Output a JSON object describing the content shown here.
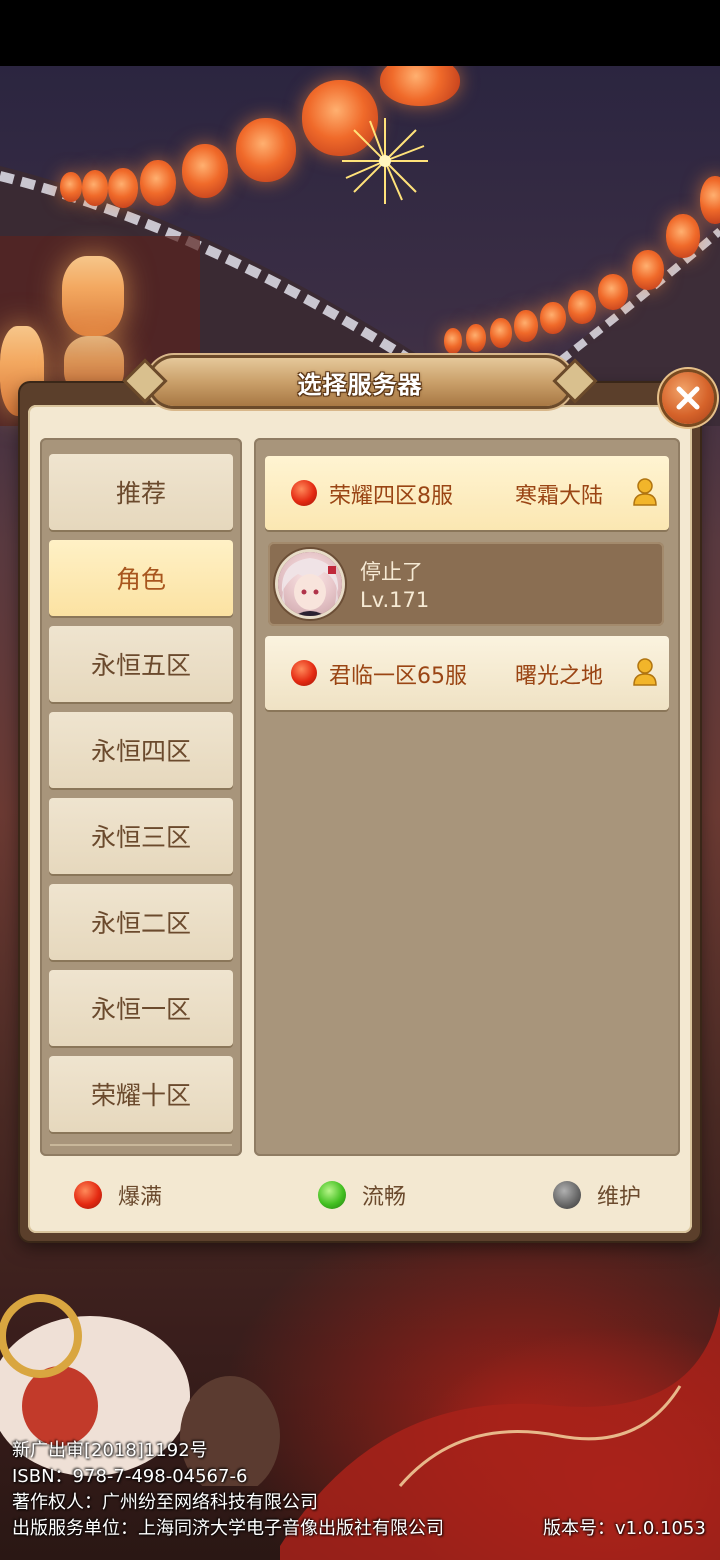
{
  "dialog": {
    "title": "选择服务器"
  },
  "categories": [
    {
      "label": "推荐",
      "active": false
    },
    {
      "label": "角色",
      "active": true
    },
    {
      "label": "永恒五区",
      "active": false
    },
    {
      "label": "永恒四区",
      "active": false
    },
    {
      "label": "永恒三区",
      "active": false
    },
    {
      "label": "永恒二区",
      "active": false
    },
    {
      "label": "永恒一区",
      "active": false
    },
    {
      "label": "荣耀十区",
      "active": false
    }
  ],
  "servers": [
    {
      "name": "荣耀四区8服",
      "region": "寒霜大陆",
      "status": "full",
      "active": true
    },
    {
      "name": "君临一区65服",
      "region": "曙光之地",
      "status": "full",
      "active": false
    }
  ],
  "role": {
    "name": "停止了",
    "level": "Lv.171"
  },
  "legend": {
    "full": "爆满",
    "smooth": "流畅",
    "maintenance": "维护"
  },
  "colors": {
    "full": "#e42a12",
    "smooth": "#43c021",
    "maintenance": "#6a6a6a"
  },
  "footer": {
    "line1": "新广出审[2018]1192号",
    "line2": "ISBN：978-7-498-04567-6",
    "line3": "著作权人：广州纷至网络科技有限公司",
    "line4": "出版服务单位：上海同济大学电子音像出版社有限公司",
    "version": "版本号：v1.0.1053"
  }
}
